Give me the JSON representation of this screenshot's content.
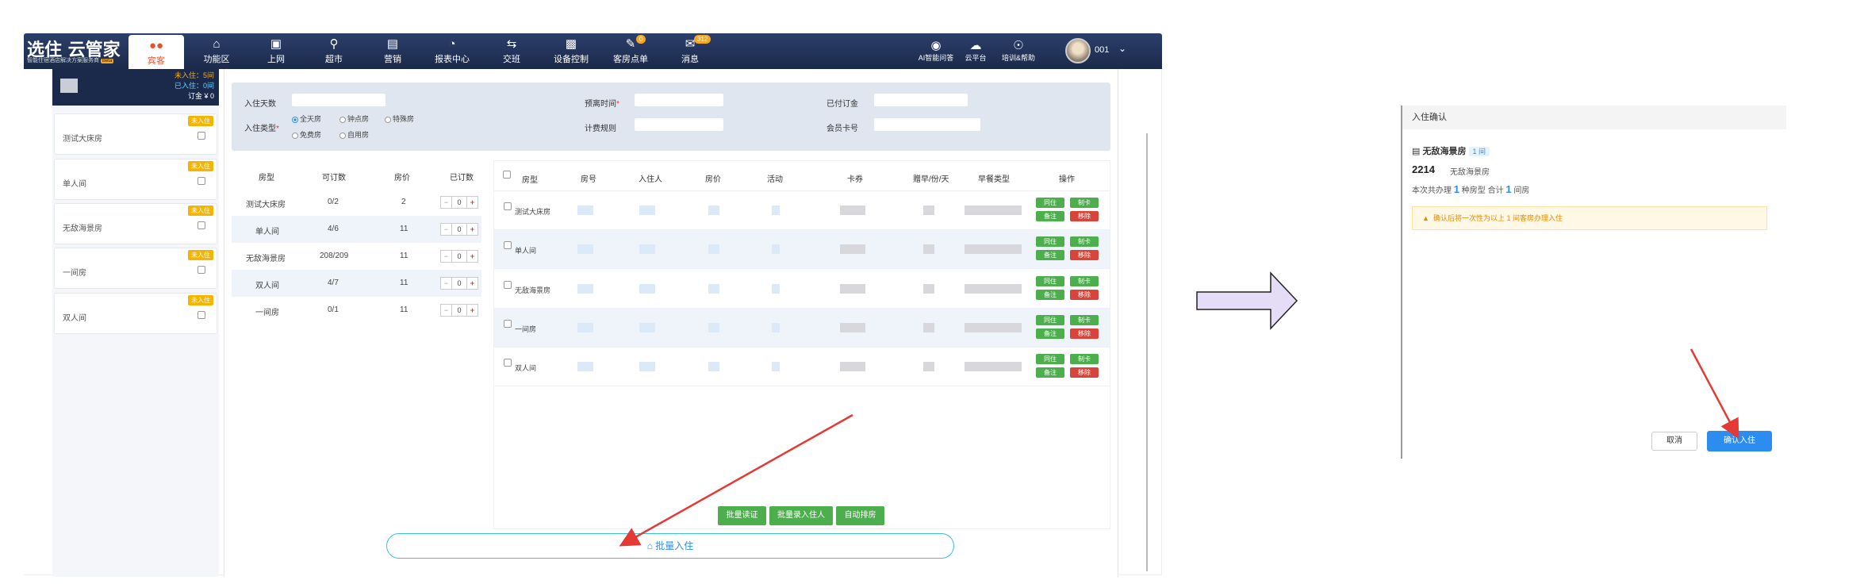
{
  "nav": {
    "logo": "选住 云管家",
    "logo_sub": "智能住宿酒店解决方案服务商",
    "logo_beta": "Beta",
    "items": [
      {
        "label": "宾客",
        "icon": "users-icon"
      },
      {
        "label": "功能区",
        "icon": "home-icon"
      },
      {
        "label": "上网",
        "icon": "monitor-icon"
      },
      {
        "label": "超市",
        "icon": "cart-icon"
      },
      {
        "label": "营销",
        "icon": "chart-icon"
      },
      {
        "label": "报表中心",
        "icon": "pie-icon"
      },
      {
        "label": "交班",
        "icon": "swap-icon"
      },
      {
        "label": "设备控制",
        "icon": "device-icon"
      },
      {
        "label": "客房点单",
        "icon": "order-icon",
        "badge": "0"
      },
      {
        "label": "消息",
        "icon": "message-icon",
        "badge": "312"
      }
    ],
    "right": [
      {
        "label": "AI智能问答",
        "icon": "robot-icon"
      },
      {
        "label": "云平台",
        "icon": "cloud-icon"
      },
      {
        "label": "培训&帮助",
        "icon": "help-icon"
      }
    ],
    "user": "001"
  },
  "summary": {
    "line1": "未入住：5间",
    "line2": "已入住：0间",
    "line3": "订金 ¥ 0"
  },
  "room_cards": [
    {
      "tag": "未入住",
      "name": "测试大床房"
    },
    {
      "tag": "未入住",
      "name": "单人间"
    },
    {
      "tag": "未入住",
      "name": "无敌海景房"
    },
    {
      "tag": "未入住",
      "name": "一间房"
    },
    {
      "tag": "未入住",
      "name": "双人间"
    }
  ],
  "form": {
    "stay_days_label": "入住天数",
    "stay_type_label": "入住类型",
    "stay_types": [
      "全天房",
      "钟点房",
      "特殊房",
      "免费房",
      "自用房"
    ],
    "checkout_label": "预离时间",
    "price_rule_label": "计费规则",
    "paid_label": "已付订金",
    "member_label": "会员卡号"
  },
  "left_table": {
    "headers": [
      "房型",
      "可订数",
      "房价",
      "已订数"
    ],
    "rows": [
      {
        "type": "测试大床房",
        "avail": "0/2",
        "price": "2",
        "count": "0"
      },
      {
        "type": "单人间",
        "avail": "4/6",
        "price": "11",
        "count": "0"
      },
      {
        "type": "无敌海景房",
        "avail": "208/209",
        "price": "11",
        "count": "0"
      },
      {
        "type": "双人间",
        "avail": "4/7",
        "price": "11",
        "count": "0"
      },
      {
        "type": "一间房",
        "avail": "0/1",
        "price": "11",
        "count": "0"
      }
    ]
  },
  "right_table": {
    "headers": [
      "房型",
      "房号",
      "入住人",
      "房价",
      "活动",
      "卡券",
      "赠早/份/天",
      "早餐类型",
      "操作"
    ],
    "rows": [
      "测试大床房",
      "单人间",
      "无敌海景房",
      "一间房",
      "双人间"
    ],
    "actions": {
      "checkin": "同住",
      "card": "制卡",
      "note": "备注",
      "remove": "移除"
    }
  },
  "bottom_buttons": [
    "批量读证",
    "批量录入住人",
    "自动排房"
  ],
  "batch_checkin": "批量入住",
  "dialog": {
    "title": "入住确认",
    "room_name": "无敌海景房",
    "room_count_tag": "1 间",
    "room_no": "2214",
    "room_type": "无敌海景房",
    "summary_prefix": "本次共办理",
    "summary_types": "1",
    "summary_mid": "种房型 合计",
    "summary_rooms": "1",
    "summary_suffix": "间房",
    "warning": "确认后将一次性为以上 1 间客房办理入住",
    "cancel": "取消",
    "confirm": "确认入住"
  }
}
